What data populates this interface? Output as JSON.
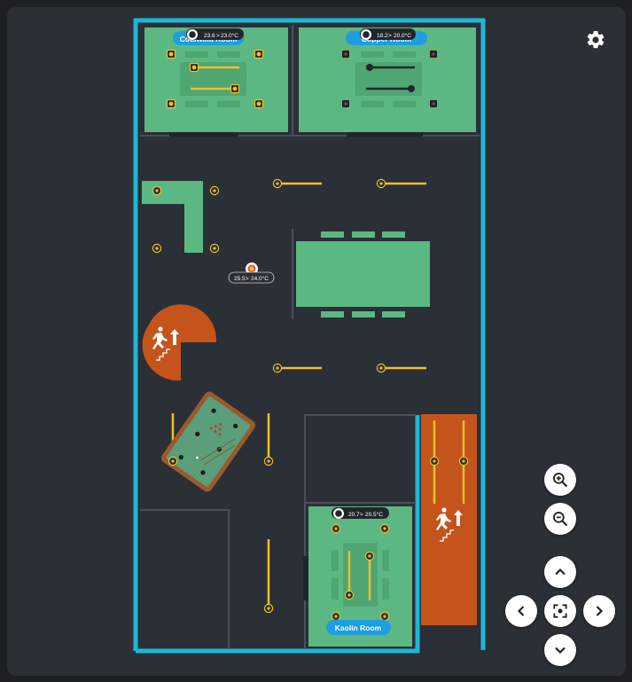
{
  "floorplan": {
    "rooms": [
      {
        "id": "room-1",
        "name": "Cotswold Room",
        "temperature": "23.6",
        "setpoint": "23.0°C"
      },
      {
        "id": "room-2",
        "name": "Copper Room",
        "temperature": "18.2",
        "setpoint": "20.0°C"
      },
      {
        "id": "room-3",
        "name": "Kaolin Room",
        "temperature": "20.7",
        "setpoint": "20.5°C"
      }
    ],
    "open_area": {
      "temperature": "25.5",
      "setpoint": "24.0°C"
    },
    "arrow": ">"
  },
  "icons": {
    "settings": "gear-icon",
    "zoom_in": "zoom-in-icon",
    "zoom_out": "zoom-out-icon",
    "pan_up": "chevron-up-icon",
    "pan_down": "chevron-down-icon",
    "pan_left": "chevron-left-icon",
    "pan_right": "chevron-right-icon",
    "recenter": "recenter-icon",
    "stairs": "emergency-exit-stairs-icon",
    "light": "light-icon",
    "thermostat": "thermostat-icon"
  },
  "colors": {
    "wall_accent": "#1bb8d6",
    "room_fill": "#5cb883",
    "exit_fill": "#c4541c",
    "light_line": "#f0bf2a",
    "label_pill": "#1e9ee0"
  }
}
